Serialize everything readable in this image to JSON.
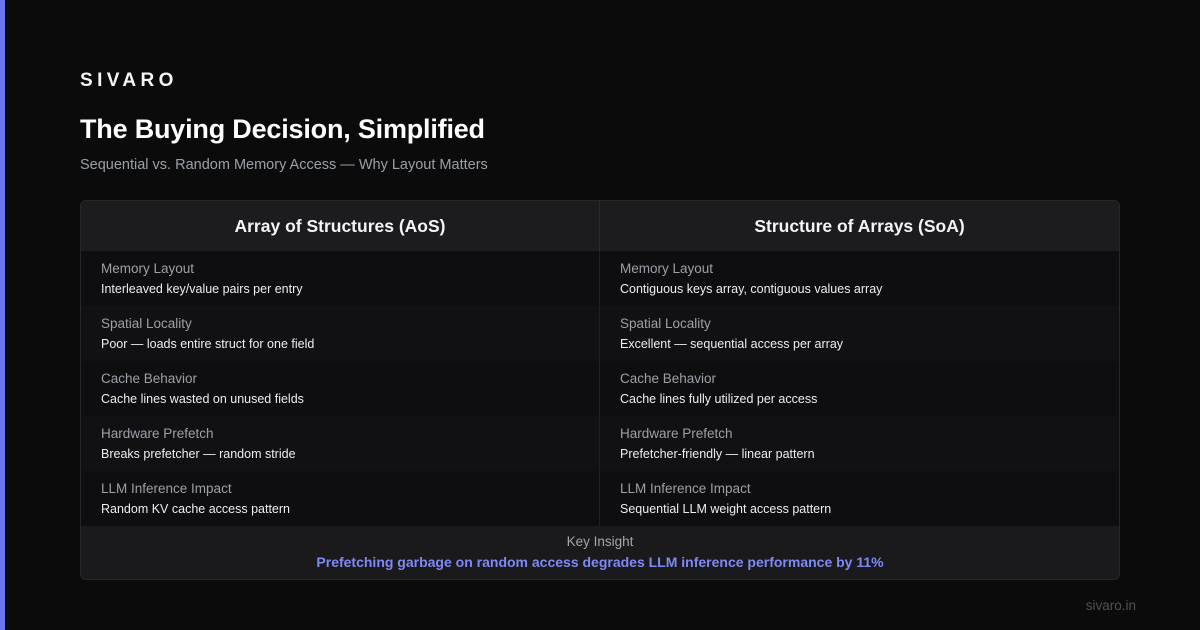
{
  "brand": "SIVARO",
  "title": "The Buying Decision, Simplified",
  "subtitle": "Sequential vs. Random Memory Access — Why Layout Matters",
  "colors": {
    "accent": "#6b75f0",
    "background": "#0b0b0c",
    "insight": "#7f89f5"
  },
  "table": {
    "headers": [
      "Array of Structures (AoS)",
      "Structure of Arrays (SoA)"
    ],
    "rows": [
      {
        "label": "Memory Layout",
        "aos": "Interleaved key/value pairs per entry",
        "soa": "Contiguous keys array, contiguous values array"
      },
      {
        "label": "Spatial Locality",
        "aos": "Poor — loads entire struct for one field",
        "soa": "Excellent — sequential access per array"
      },
      {
        "label": "Cache Behavior",
        "aos": "Cache lines wasted on unused fields",
        "soa": "Cache lines fully utilized per access"
      },
      {
        "label": "Hardware Prefetch",
        "aos": "Breaks prefetcher — random stride",
        "soa": "Prefetcher-friendly — linear pattern"
      },
      {
        "label": "LLM Inference Impact",
        "aos": "Random KV cache access pattern",
        "soa": "Sequential LLM weight access pattern"
      }
    ]
  },
  "insight": {
    "label": "Key Insight",
    "text": "Prefetching garbage on random access degrades LLM inference performance by 11%"
  },
  "site": "sivaro.in"
}
